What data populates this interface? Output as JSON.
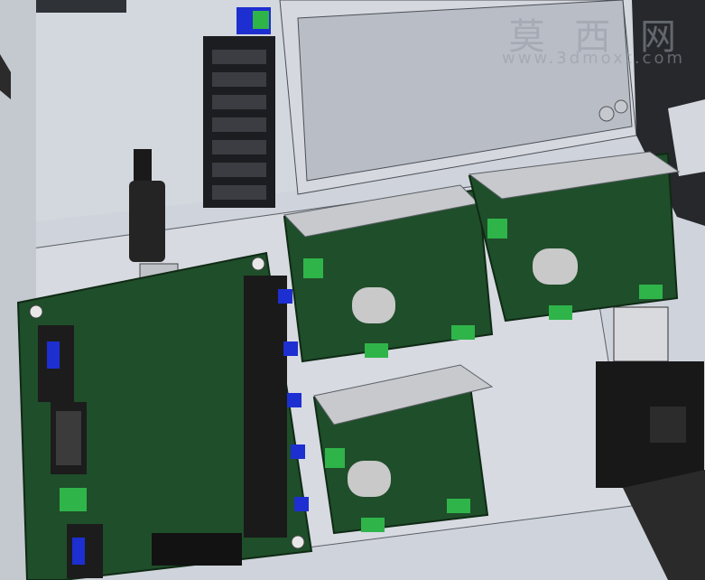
{
  "watermark": {
    "chinese": "莫 西 网",
    "url": "www.3dmoxt.com"
  },
  "colors": {
    "panel": "#d9dce3",
    "pcb": "#1f4e2a",
    "pcb_edge": "#2c6b3a",
    "heatsink": "#c7c9cc",
    "terminal": "#2fb44a",
    "connector": "#1c1c1c",
    "blue_part": "#1d2fd0",
    "capacitor": "#c9c9c9"
  },
  "scene": {
    "description_icons": [
      "usb-plug-icon",
      "terminal-block-icon",
      "heatsink-icon",
      "capacitor-icon"
    ]
  }
}
